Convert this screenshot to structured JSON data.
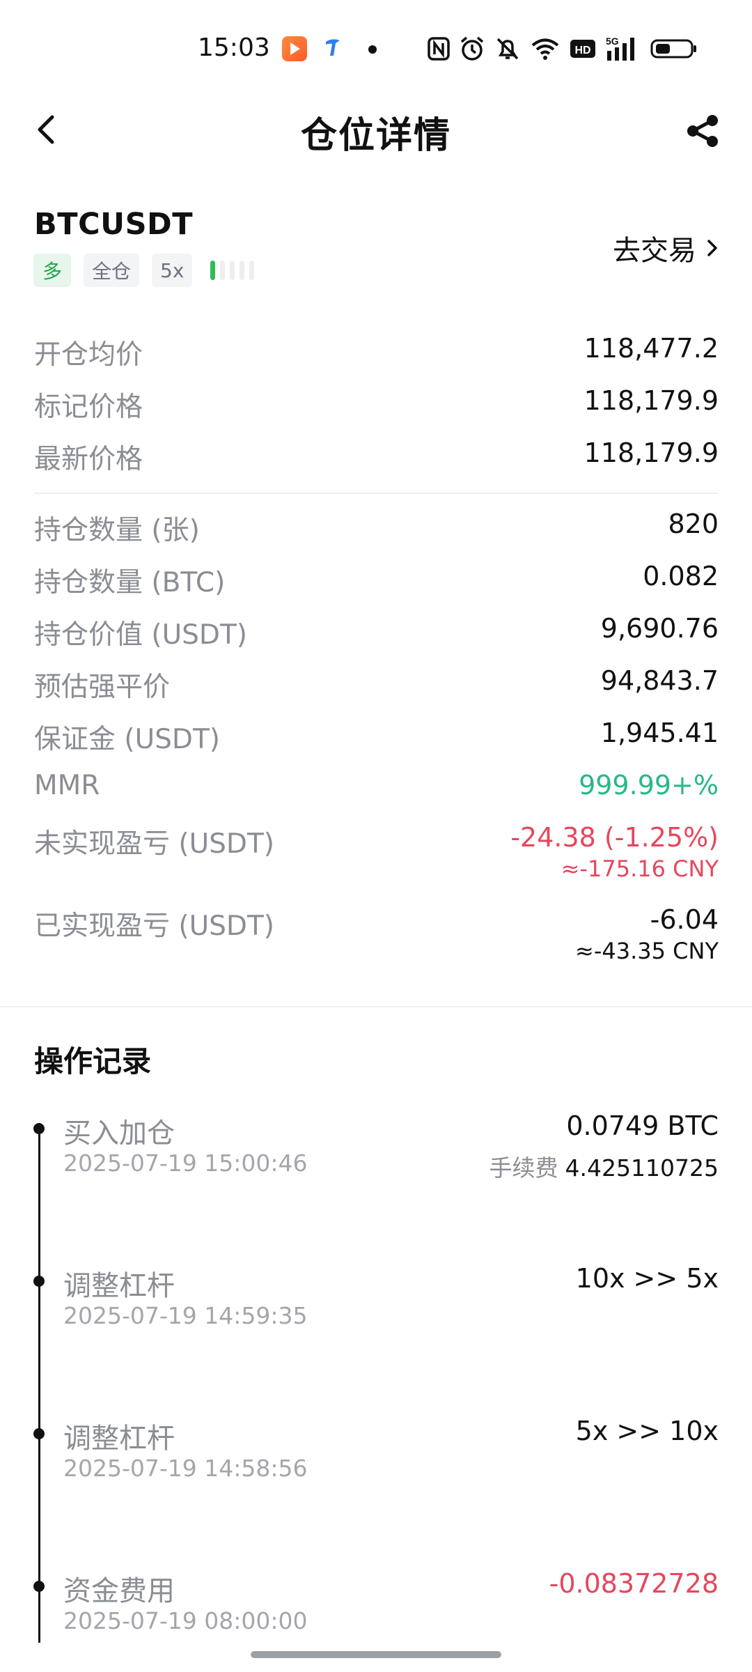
{
  "status_bar": {
    "time": "15:03",
    "icons": [
      "video-app-icon",
      "telecom-app-icon",
      "notification-dot",
      "nfc-icon",
      "alarm-icon",
      "mute-icon",
      "wifi-icon",
      "hd-icon",
      "signal-5g-icon",
      "battery-icon"
    ],
    "network": "5G",
    "hd_label": "HD"
  },
  "header": {
    "title": "仓位详情",
    "back_icon": "chevron-left-icon",
    "share_icon": "share-icon"
  },
  "position": {
    "symbol": "BTCUSDT",
    "direction": "多",
    "margin_mode": "全仓",
    "leverage": "5x",
    "trade_link": "去交易",
    "risk_level": 1,
    "risk_segments": 5
  },
  "price_rows": [
    {
      "label": "开仓均价",
      "value": "118,477.2"
    },
    {
      "label": "标记价格",
      "value": "118,179.9"
    },
    {
      "label": "最新价格",
      "value": "118,179.9"
    }
  ],
  "detail_rows": [
    {
      "label": "持仓数量 (张)",
      "value": "820"
    },
    {
      "label": "持仓数量 (BTC)",
      "value": "0.082"
    },
    {
      "label": "持仓价值 (USDT)",
      "value": "9,690.76"
    },
    {
      "label": "预估强平价",
      "value": "94,843.7"
    },
    {
      "label": "保证金 (USDT)",
      "value": "1,945.41"
    },
    {
      "label": "MMR",
      "value": "999.99+%"
    }
  ],
  "pnl": {
    "unrealized_label": "未实现盈亏 (USDT)",
    "unrealized_value": "-24.38 (-1.25%)",
    "unrealized_cny": "≈-175.16 CNY",
    "realized_label": "已实现盈亏 (USDT)",
    "realized_value": "-6.04",
    "realized_cny": "≈-43.35 CNY"
  },
  "records": {
    "title": "操作记录",
    "items": [
      {
        "title": "买入加仓",
        "time": "2025-07-19 15:00:46",
        "value": "0.0749 BTC",
        "fee_label": "手续费",
        "fee_value": "4.425110725"
      },
      {
        "title": "调整杠杆",
        "time": "2025-07-19 14:59:35",
        "value": "10x >> 5x"
      },
      {
        "title": "调整杠杆",
        "time": "2025-07-19 14:58:56",
        "value": "5x >> 10x"
      },
      {
        "title": "资金费用",
        "time": "2025-07-19 08:00:00",
        "value": "-0.08372728"
      }
    ]
  },
  "colors": {
    "profit_green": "#28b885",
    "loss_red": "#e5475d",
    "long_tag_green": "#1fa34a",
    "label_gray": "#8a8d93"
  }
}
